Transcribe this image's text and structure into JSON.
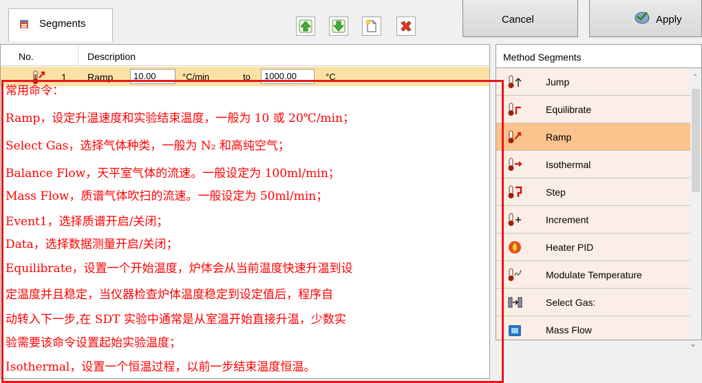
{
  "tab": {
    "label": "Segments"
  },
  "toolbar": {
    "move_up": "move-up",
    "move_down": "move-down",
    "new": "new-segment",
    "delete": "delete-segment"
  },
  "buttons": {
    "cancel": "Cancel",
    "apply": "Apply"
  },
  "table": {
    "col_no": "No.",
    "col_description": "Description",
    "row": {
      "no": "1",
      "type": "Ramp",
      "rate": "10.00",
      "rate_unit": "°C/min",
      "to": "to",
      "end_temp": "1000.00",
      "temp_unit": "°C"
    }
  },
  "method_segments": {
    "title": "Method Segments",
    "items": [
      {
        "label": "Jump"
      },
      {
        "label": "Equilibrate"
      },
      {
        "label": "Ramp",
        "selected": true
      },
      {
        "label": "Isothermal"
      },
      {
        "label": "Step"
      },
      {
        "label": "Increment"
      },
      {
        "label": "Heater PID"
      },
      {
        "label": "Modulate Temperature"
      },
      {
        "label": "Select Gas:"
      },
      {
        "label": "Mass Flow"
      }
    ]
  },
  "annotation": {
    "lines": [
      "常用命令：",
      "Ramp，设定升温速度和实验结束温度，一般为 10 或 20℃/min；",
      "Select Gas，选择气体种类，一般为 N₂ 和高纯空气；",
      "Balance Flow，天平室气体的流速。一般设定为 100ml/min；",
      "Mass Flow，质谱气体吹扫的流速。一般设定为 50ml/min；",
      "Event1，选择质谱开启/关闭；",
      "Data，选择数据测量开启/关闭；",
      "Equilibrate，设置一个开始温度，炉体会从当前温度快速升温到设",
      "定温度并且稳定，当仪器检查炉体温度稳定到设定值后，程序自",
      "动转入下一步,在 SDT 实验中通常是从室温开始直接升温，少数实",
      "验需要该命令设置起始实验温度；",
      "Isothermal，设置一个恒温过程，以前一步结束温度恒温。"
    ]
  },
  "colors": {
    "selected_row": "#fbe1a4",
    "selected_item": "#fbc38d",
    "item_bg": "#fbeee6",
    "annotation_red": "#ff0000"
  }
}
